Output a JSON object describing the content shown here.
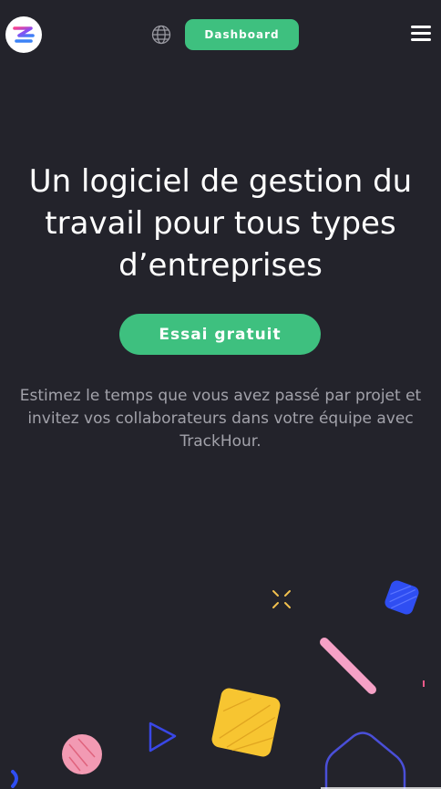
{
  "header": {
    "logo_icon": "trackhour-logo-icon",
    "language_icon": "globe-icon",
    "dashboard_label": "Dashboard",
    "menu_icon": "hamburger-menu-icon"
  },
  "hero": {
    "title": "Un logiciel de gestion du travail pour tous types d’entreprises",
    "cta_label": "Essai gratuit",
    "subtitle": "Estimez le temps que vous avez passé par projet et invitez vos collaborateurs dans votre équipe avec TrackHour."
  },
  "colors": {
    "background": "#23232b",
    "accent_green": "#3ec07f",
    "text_muted": "#a2a2aa"
  }
}
